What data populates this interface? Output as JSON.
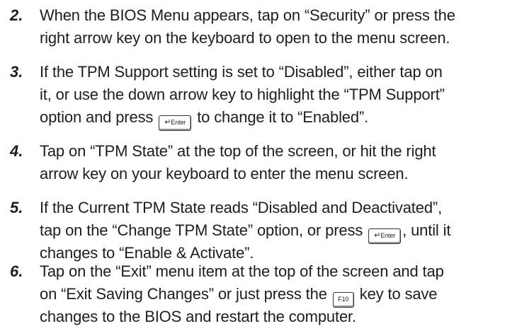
{
  "steps": [
    {
      "number": "2.",
      "lines": [
        "When the BIOS Menu appears, tap on “Security” or press the",
        "right arrow key on the keyboard to open to the menu screen."
      ]
    },
    {
      "number": "3.",
      "lines": [
        "If the TPM Support setting is set to “Disabled”, either tap on",
        "it, or use the down arrow key to highlight the “TPM Support”",
        [
          "option and press ",
          " to change it to “Enabled”."
        ]
      ]
    },
    {
      "number": "4.",
      "lines": [
        "Tap on “TPM State” at the top of the screen, or hit the right",
        "arrow key on your keyboard to enter the menu screen."
      ]
    },
    {
      "number": "5.",
      "lines": [
        "If the Current TPM State reads “Disabled and Deactivated”,",
        [
          "tap on the “Change TPM State” option, or press ",
          ", until it"
        ],
        "changes to “Enable & Activate”."
      ]
    },
    {
      "number": "6.",
      "lines": [
        "Tap on the “Exit” menu item at the top of the screen and tap",
        [
          "on “Exit Saving Changes” or just press the ",
          " key to save"
        ],
        "changes to the BIOS and restart the computer."
      ]
    }
  ],
  "keys": {
    "enter_arrow": "↵",
    "enter_label": "Enter",
    "f10_label": "F10"
  },
  "icons": {
    "enter_key": "enter-key-icon",
    "f10_key": "f10-key-icon"
  }
}
